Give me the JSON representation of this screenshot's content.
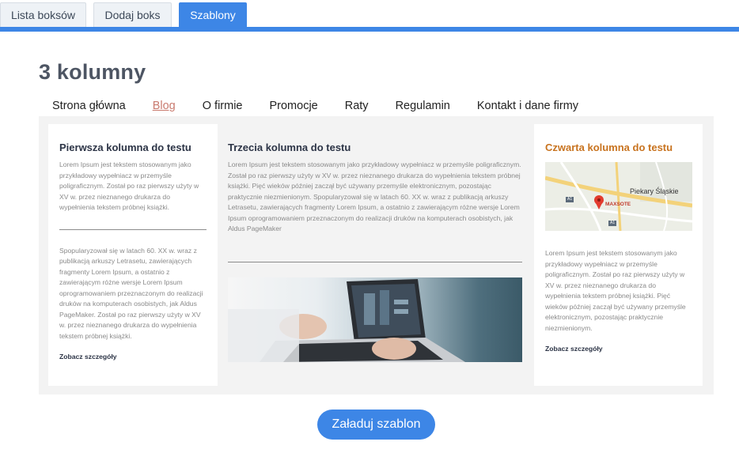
{
  "tabs": [
    {
      "label": "Lista boksów"
    },
    {
      "label": "Dodaj boks"
    },
    {
      "label": "Szablony",
      "active": true
    }
  ],
  "page_title": "3 kolumny",
  "nav": [
    {
      "label": "Strona główna"
    },
    {
      "label": "Blog",
      "active": true
    },
    {
      "label": "O firmie"
    },
    {
      "label": "Promocje"
    },
    {
      "label": "Raty"
    },
    {
      "label": "Regulamin"
    },
    {
      "label": "Kontakt i dane firmy"
    }
  ],
  "columns": {
    "first": {
      "title": "Pierwsza kolumna do testu",
      "text1": "Lorem Ipsum jest tekstem stosowanym jako przykładowy wypełniacz w przemyśle poligraficznym. Został po raz pierwszy użyty w XV w. przez nieznanego drukarza do wypełnienia tekstem próbnej książki.",
      "text2": "Spopularyzował się w latach 60. XX w. wraz z publikacją arkuszy Letrasetu, zawierających fragmenty Lorem Ipsum, a ostatnio z zawierającym różne wersje Lorem Ipsum oprogramowaniem przeznaczonym do realizacji druków na komputerach osobistych, jak Aldus PageMaker. Został po raz pierwszy użyty w XV w. przez nieznanego drukarza do wypełnienia tekstem próbnej książki.",
      "details": "Zobacz szczegóły"
    },
    "third": {
      "title": "Trzecia kolumna do testu",
      "text": "Lorem Ipsum jest tekstem stosowanym jako przykładowy wypełniacz w przemyśle poligraficznym. Został po raz pierwszy użyty w XV w. przez nieznanego drukarza do wypełnienia tekstem próbnej książki. Pięć wieków później zaczął być używany przemyśle elektronicznym, pozostając praktycznie niezmienionym. Spopularyzował się w latach 60. XX w. wraz z publikacją arkuszy Letrasetu, zawierających fragmenty Lorem Ipsum, a ostatnio z zawierającym różne wersje Lorem Ipsum oprogramowaniem przeznaczonym do realizacji druków na komputerach osobistych, jak Aldus PageMaker"
    },
    "fourth": {
      "title": "Czwarta kolumna do testu",
      "map_label_city": "Piekary Śląskie",
      "map_label_marker": "MAXSOTE",
      "map_road_a1": "A1",
      "map_road_a1b": "A1",
      "text": "Lorem Ipsum jest tekstem stosowanym jako przykładowy wypełniacz w przemyśle poligraficznym. Został po raz pierwszy użyty w XV w. przez nieznanego drukarza do wypełnienia tekstem próbnej książki. Pięć wieków później zaczął być używany przemyśle elektronicznym, pozostając praktycznie niezmienionym.",
      "details": "Zobacz szczegóły"
    }
  },
  "load_button": "Załaduj szablon",
  "colors": {
    "accent": "#3d86e6",
    "title_orange": "#c8731f",
    "nav_active": "#c97a6e"
  }
}
